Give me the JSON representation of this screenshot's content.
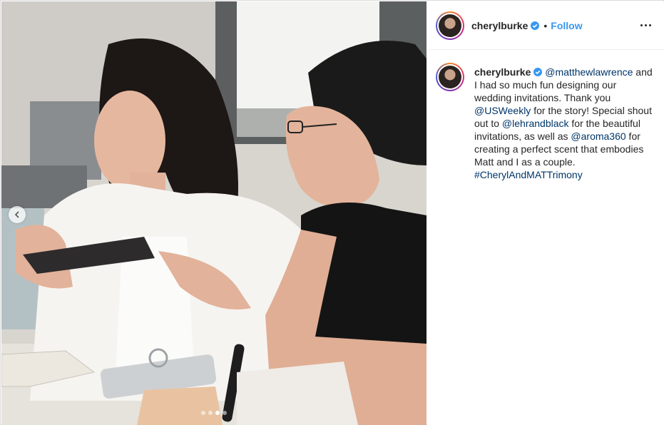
{
  "post": {
    "username": "cherylburke",
    "follow_label": "Follow",
    "separator": "•",
    "caption": {
      "username": "cherylburke",
      "mention_1": "@matthewlawrence",
      "text_1": " and I had so much fun designing our wedding invitations. Thank you ",
      "mention_2": "@USWeekly",
      "text_2": " for the story! Special shout out to ",
      "mention_3": "@lehrandblack",
      "text_3": " for the beautiful invitations, as well as ",
      "mention_4": "@aroma360",
      "text_4": " for creating a perfect scent that embodies Matt and I as a couple. ",
      "hashtag": "#CherylAndMATTrimony"
    },
    "carousel": {
      "slides": 4,
      "active_index": 2
    }
  },
  "colors": {
    "accent": "#3897f0",
    "link": "#003569",
    "verified": "#3897f0"
  },
  "icons": [
    "verified-badge-icon",
    "more-options-icon",
    "chevron-left-icon"
  ]
}
